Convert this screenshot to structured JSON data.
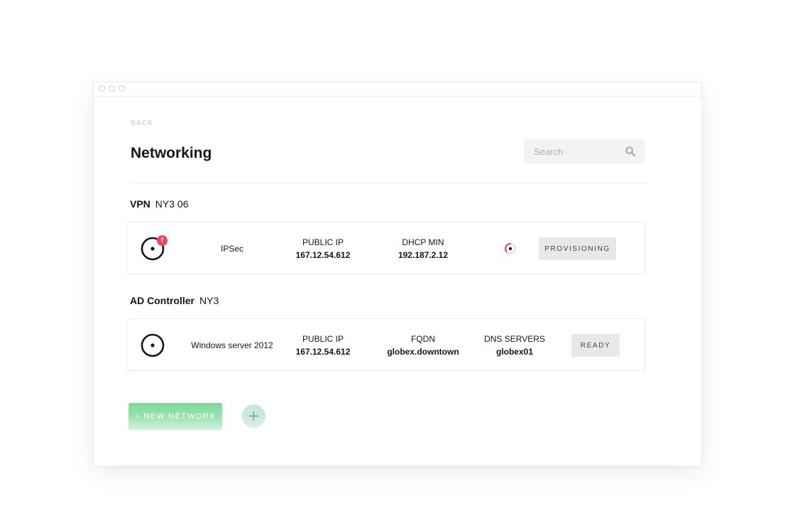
{
  "nav": {
    "back_label": "BACK"
  },
  "header": {
    "title": "Networking"
  },
  "search": {
    "placeholder": "Search",
    "value": ""
  },
  "sections": [
    {
      "type_label": "VPN",
      "location": "NY3 06",
      "card": {
        "protocol": "IPSec",
        "alert_mark": "!",
        "fields": [
          {
            "label": "PUBLIC IP",
            "value": "167.12.54.612"
          },
          {
            "label": "DHCP MIN",
            "value": "192.187.2.12"
          }
        ],
        "status": "PROVISIONING"
      }
    },
    {
      "type_label": "AD Controller",
      "location": "NY3",
      "card": {
        "os": "Windows server 2012",
        "fields": [
          {
            "label": "PUBLIC IP",
            "value": "167.12.54.612"
          },
          {
            "label": "FQDN",
            "value": "globex.downtown"
          },
          {
            "label": "DNS SERVERS",
            "value": "globex01"
          }
        ],
        "status": "READY"
      }
    }
  ],
  "footer": {
    "new_network_label": "+ NEW NETWORK"
  },
  "icons": {
    "network": "network-disc-icon",
    "alert": "alert-icon",
    "search": "search-icon",
    "spinner": "loading-spinner-icon",
    "add": "plus-icon"
  },
  "colors": {
    "alert": "#f2455c",
    "primary_green": "#7dd99a",
    "status_bg": "#e8e8e9",
    "title_text": "#15161c"
  }
}
